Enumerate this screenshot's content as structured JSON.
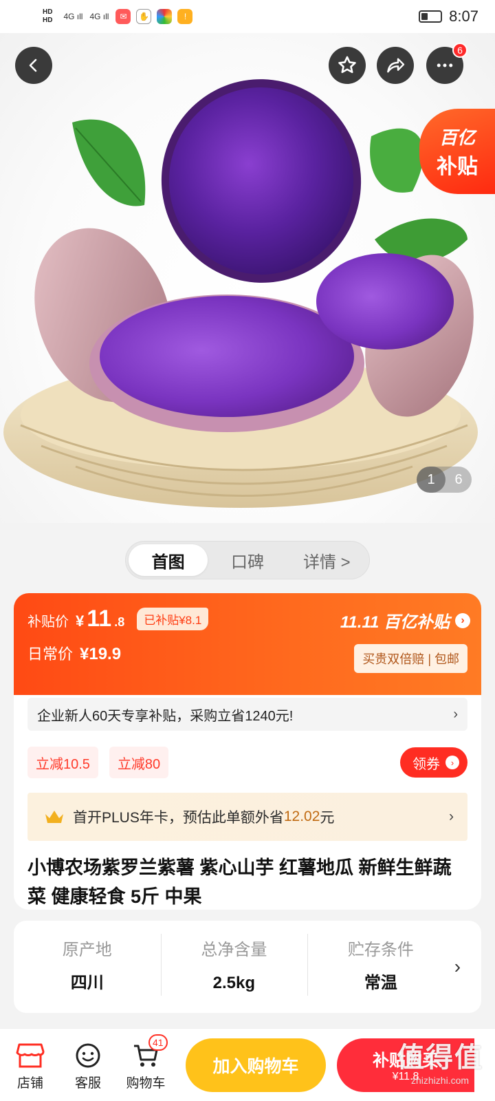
{
  "status_bar": {
    "net_top": "HD",
    "net_bottom": "HD",
    "signal1": "4G ıll",
    "signal2": "4G ıll",
    "time": "8:07",
    "battery_level": 0.35
  },
  "header": {
    "menu_badge": "6"
  },
  "hero": {
    "subsidy_line1": "百亿",
    "subsidy_line2": "补贴",
    "image_index": "1",
    "image_total": "6"
  },
  "tabs": [
    {
      "label": "首图",
      "active": true
    },
    {
      "label": "口碑",
      "active": false
    },
    {
      "label": "详情 >",
      "active": false
    }
  ],
  "price": {
    "subsidy_label": "补贴价",
    "currency": "¥",
    "subsidy_int": "11",
    "subsidy_dec": ".8",
    "subsidized_tag": "已补贴¥8.1",
    "regular_label": "日常价",
    "regular_price": "¥19.9",
    "brand": "11.11 百亿补贴",
    "brand_arrow": "›",
    "guarantee": "买贵双倍赔 | 包邮"
  },
  "notice": {
    "text": "企业新人60天专享补贴，采购立省1240元!",
    "chevron": "›"
  },
  "coupons": {
    "items": [
      "立减10.5",
      "立减80"
    ],
    "get_label": "领券",
    "get_arrow": "›"
  },
  "plus": {
    "text_before": "首开PLUS年卡，预估此单额外省",
    "amount": "12.02",
    "text_after": "元",
    "chevron": "›"
  },
  "product": {
    "title": "小博农场紫罗兰紫薯 紫心山芋  红薯地瓜 新鲜生鲜蔬菜 健康轻食 5斤 中果"
  },
  "specs": [
    {
      "label": "原产地",
      "value": "四川"
    },
    {
      "label": "总净含量",
      "value": "2.5kg"
    },
    {
      "label": "贮存条件",
      "value": "常温"
    }
  ],
  "spec_chevron": "›",
  "bottom": {
    "store": "店铺",
    "service": "客服",
    "cart": "购物车",
    "cart_badge": "41",
    "add_cart": "加入购物车",
    "buy_line1": "补贴购买",
    "buy_line2": "¥11.8"
  },
  "watermark": {
    "line1": "值得值",
    "line2": "zhizhizhi.com"
  },
  "colors": {
    "accent": "#ff4a14",
    "buy": "#ff2d3a",
    "add_cart": "#ffc21a"
  }
}
